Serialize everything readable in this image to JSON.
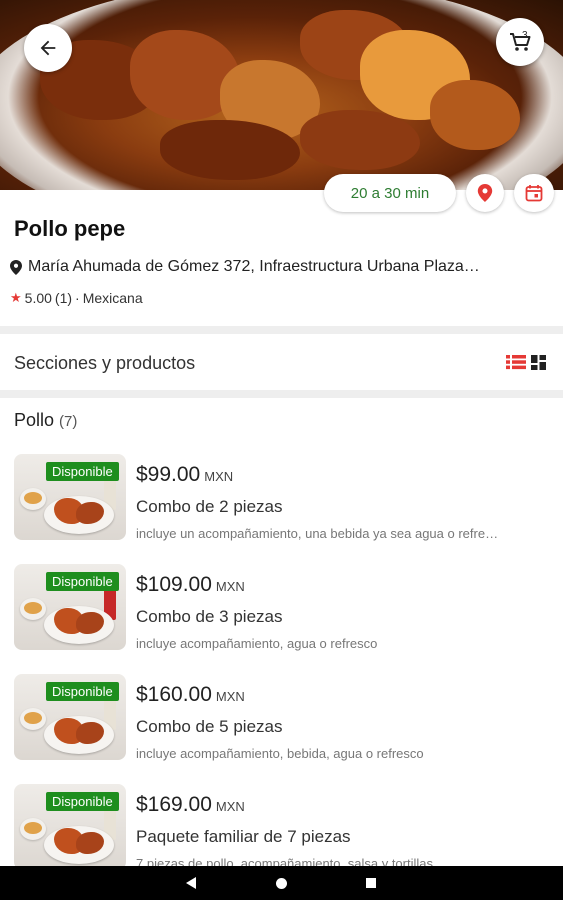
{
  "store": {
    "name": "Pollo pepe",
    "address": "María Ahumada de Gómez 372, Infraestructura Urbana Plaza…",
    "rating": "5.00",
    "rating_count": "(1)",
    "rating_separator": "·",
    "category": "Mexicana",
    "delivery_time": "20 a 30 min"
  },
  "header": {
    "cart_count": "3",
    "icons": {
      "back": "arrow-left-icon",
      "cart": "cart-icon",
      "location": "map-pin-icon",
      "calendar": "calendar-icon"
    }
  },
  "sections": {
    "label": "Secciones y productos",
    "view_icons": [
      "list-view-icon",
      "grid-view-icon"
    ],
    "accent_color": "#e53935"
  },
  "category": {
    "name": "Pollo",
    "count": "(7)"
  },
  "products": [
    {
      "badge": "Disponible",
      "price": "$99.00",
      "currency": "MXN",
      "name": "Combo de 2 piezas",
      "description": "incluye un acompañamiento, una bebida ya sea agua o refre…"
    },
    {
      "badge": "Disponible",
      "price": "$109.00",
      "currency": "MXN",
      "name": "Combo de 3 piezas",
      "description": "incluye acompañamiento, agua o refresco"
    },
    {
      "badge": "Disponible",
      "price": "$160.00",
      "currency": "MXN",
      "name": "Combo de 5 piezas",
      "description": "incluye acompañamiento, bebida, agua o refresco"
    },
    {
      "badge": "Disponible",
      "price": "$169.00",
      "currency": "MXN",
      "name": "Paquete familiar de 7 piezas",
      "description": "7 piezas de pollo, acompañamiento, salsa y tortillas"
    }
  ],
  "colors": {
    "available_badge": "#1e8e1e",
    "delivery_time": "#2e7d32",
    "rating_star": "#e53935"
  },
  "system_nav": [
    "nav-back-icon",
    "nav-home-icon",
    "nav-recents-icon"
  ]
}
